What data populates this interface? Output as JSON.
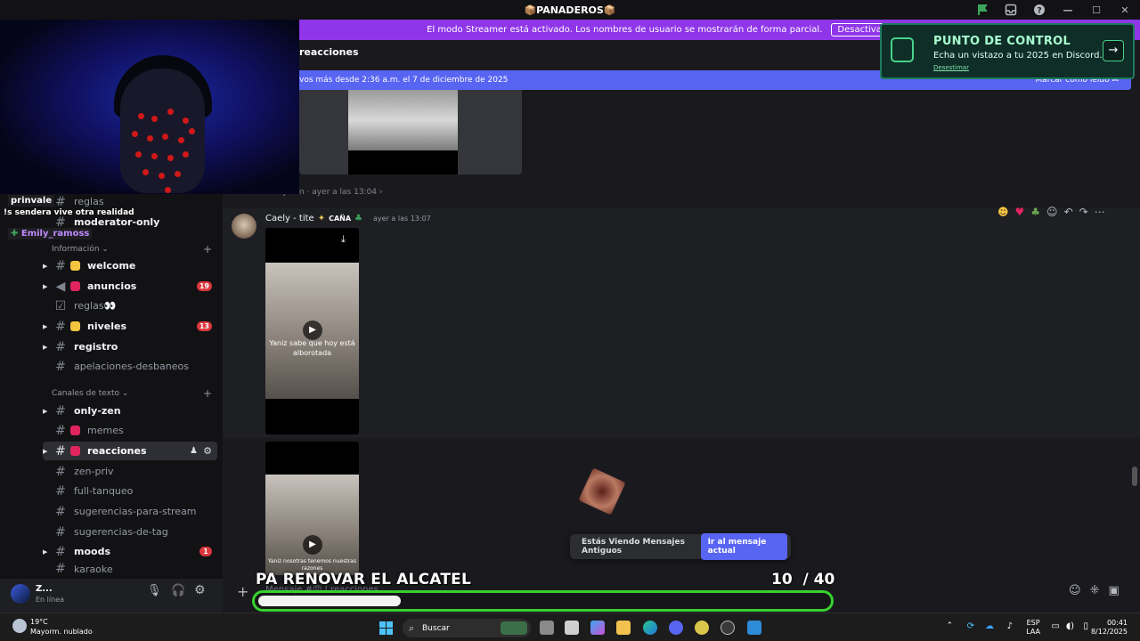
{
  "window": {
    "title": "📦PANADEROS📦"
  },
  "streamer_banner": {
    "text": "El modo Streamer está activado. Los nombres de usuario se mostrarán de forma parcial.",
    "button": "Desactivar"
  },
  "checkpoint": {
    "title": "PUNTO DE CONTROL",
    "subtitle": "Echa un vistazo a tu 2025 en Discord.",
    "dismiss": "Desestimar"
  },
  "stream_chat": {
    "user1": "prinvale",
    "message1": "!s sendera vive otra realidad",
    "user2": "Emily_ramoss"
  },
  "sidebar": {
    "partial_top_1": "reglas",
    "partial_top_2": "moderator-only",
    "category_info": "Información",
    "channels_info": [
      {
        "label": "welcome"
      },
      {
        "label": "anuncios",
        "badge": "19"
      },
      {
        "label": "reglas👀"
      },
      {
        "label": "niveles",
        "badge": "13"
      },
      {
        "label": "registro"
      },
      {
        "label": "apelaciones-desbaneos"
      }
    ],
    "category_text": "Canales de texto",
    "channels_text": [
      {
        "label": "only-zen"
      },
      {
        "label": "memes"
      },
      {
        "label": "reacciones"
      },
      {
        "label": "zen-priv"
      },
      {
        "label": "full-tanqueo"
      },
      {
        "label": "sugerencias-para-stream"
      },
      {
        "label": "sugerencias-de-tag"
      },
      {
        "label": "moods",
        "badge": "1"
      },
      {
        "label": "karaoke"
      }
    ]
  },
  "user_panel": {
    "name": "Z...",
    "status": "En línea"
  },
  "main": {
    "channel_header": "reacciones",
    "new_messages_text": "vos más desde 2:36 a.m. el 7 de diciembre de 2025",
    "mark_read": "Marcar como leído",
    "reply_context": "#only-zen  ·  ayer a las 13:04  ›",
    "message": {
      "author": "Caely - tite",
      "role": "CAÑA",
      "timestamp": "ayer a las 13:07",
      "video1_caption": "Yaniz sabe que hoy está alborotada",
      "video2_caption": "Yaniz nosotras tenemos nuestras razones"
    },
    "old_messages_toast": "Estás Viendo Mensajes Antiguos",
    "jump_button": "Ir al mensaje actual",
    "composer_placeholder": "Mensaje #😡 | reacciones"
  },
  "goal_overlay": {
    "title": "PA RENOVAR EL ALCATEL",
    "current": "10",
    "total": "/ 40",
    "progress": 0.25,
    "color": "#38d12e"
  },
  "taskbar": {
    "temperature": "19°C",
    "weather": "Mayorm. nublado",
    "search": "Buscar",
    "lang1": "ESP",
    "lang2": "LAA",
    "time": "00:41",
    "date": "8/12/2025"
  }
}
